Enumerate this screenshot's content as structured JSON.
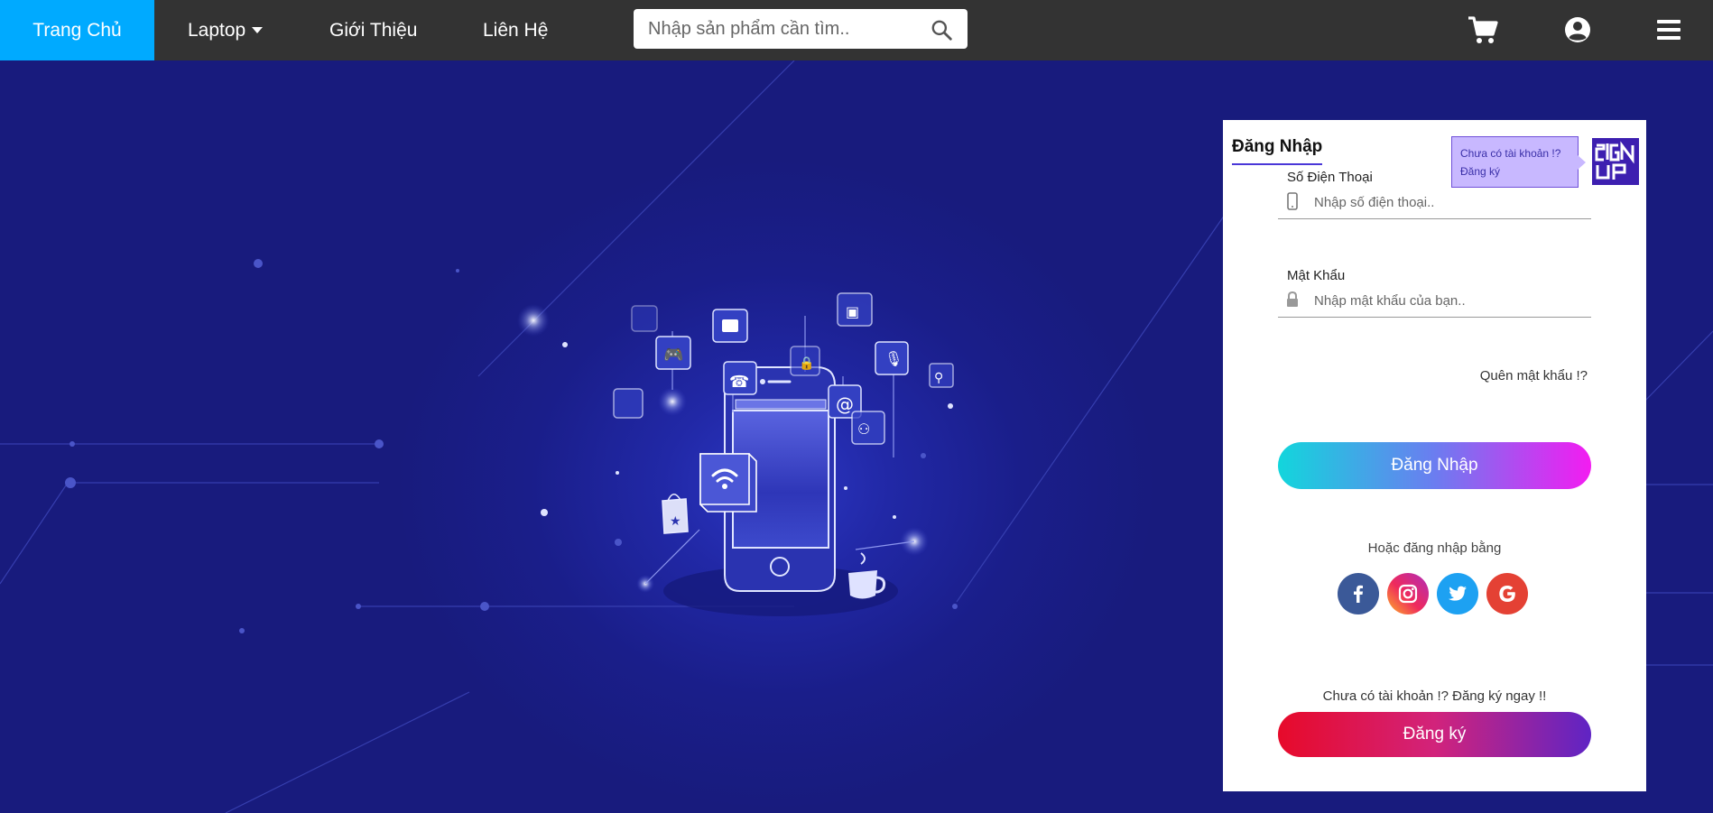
{
  "nav": {
    "home": "Trang Chủ",
    "laptop": "Laptop",
    "about": "Giới Thiệu",
    "contact": "Liên Hệ",
    "search_placeholder": "Nhập sản phẩm cần tìm.."
  },
  "login": {
    "title": "Đăng Nhập",
    "tooltip_line1": "Chưa có tài khoản !?",
    "tooltip_line2": "Đăng ký",
    "logo_letters": "SIGN UP",
    "phone_label": "Số Điện Thoại",
    "phone_placeholder": "Nhập số điện thoại..",
    "password_label": "Mật Khẩu",
    "password_placeholder": "Nhập mật khẩu của bạn..",
    "forgot": "Quên mật khẩu !?",
    "submit": "Đăng Nhập",
    "or_text": "Hoặc đăng nhập bằng",
    "no_account": "Chưa có tài khoản !? Đăng ký ngay !!",
    "register": "Đăng ký"
  },
  "colors": {
    "navbar": "#333333",
    "nav_active": "#00aaff",
    "hero_bg": "#1a1d80",
    "panel_bg": "#ffffff"
  },
  "social": [
    "facebook",
    "instagram",
    "twitter",
    "google"
  ]
}
